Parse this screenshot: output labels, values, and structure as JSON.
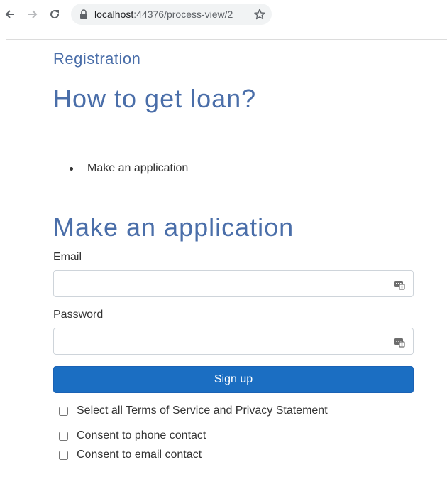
{
  "browser": {
    "url_host": "localhost",
    "url_path": ":44376/process-view/2"
  },
  "page": {
    "breadcrumb": "Registration",
    "title": "How to get loan?",
    "steps": [
      {
        "label": "Make an application"
      }
    ]
  },
  "form": {
    "title": "Make an application",
    "email_label": "Email",
    "email_value": "",
    "password_label": "Password",
    "password_value": "",
    "submit_label": "Sign up",
    "checkboxes": [
      {
        "label": "Select all Terms of Service and Privacy Statement",
        "checked": false
      },
      {
        "label": "Consent to phone contact",
        "checked": false
      },
      {
        "label": "Consent to email contact",
        "checked": false
      }
    ]
  },
  "icons": {
    "back": "arrow-left-icon",
    "forward": "arrow-right-icon",
    "reload": "reload-icon",
    "lock": "lock-icon",
    "bookmark": "star-icon",
    "autofill": "password-manager-icon"
  },
  "colors": {
    "heading": "#4a6ea9",
    "button": "#1b6ec2",
    "text": "#333333"
  }
}
